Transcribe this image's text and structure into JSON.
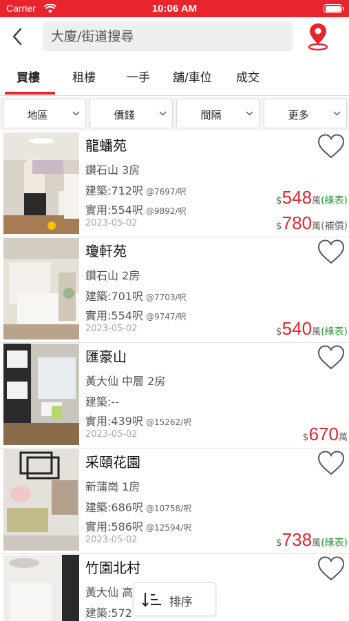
{
  "status_bar": {
    "carrier": "Carrier",
    "time": "10:06 AM"
  },
  "search": {
    "placeholder": "大廈/街道搜尋"
  },
  "tabs": [
    {
      "label": "買樓",
      "active": true
    },
    {
      "label": "租樓",
      "active": false
    },
    {
      "label": "一手",
      "active": false
    },
    {
      "label": "舖/車位",
      "active": false
    },
    {
      "label": "成交",
      "active": false
    }
  ],
  "filters": [
    {
      "label": "地區"
    },
    {
      "label": "價錢"
    },
    {
      "label": "間隔"
    },
    {
      "label": "更多"
    }
  ],
  "listings": [
    {
      "title": "龍蟠苑",
      "district": "鑽石山  3房",
      "gross": "建築:712呎",
      "gross_unit": "@7697/呎",
      "net": "實用:554呎",
      "net_unit": "@9892/呎",
      "date": "2023-05-02",
      "prices": [
        {
          "currency": "$",
          "amount": "548",
          "unit": "萬",
          "tag": "(綠表)",
          "tag_color": "green"
        },
        {
          "currency": "$",
          "amount": "780",
          "unit": "萬",
          "tag": "(補價)",
          "tag_color": "grey"
        }
      ]
    },
    {
      "title": "瓊軒苑",
      "district": "鑽石山  2房",
      "gross": "建築:701呎",
      "gross_unit": "@7703/呎",
      "net": "實用:554呎",
      "net_unit": "@9747/呎",
      "date": "2023-05-02",
      "prices": [
        {
          "currency": "$",
          "amount": "540",
          "unit": "萬",
          "tag": "(綠表)",
          "tag_color": "green"
        }
      ]
    },
    {
      "title": "匯豪山",
      "district": "黃大仙 中層 2房",
      "gross": "建築:--",
      "gross_unit": "",
      "net": "實用:439呎",
      "net_unit": "@15262/呎",
      "date": "2023-05-02",
      "prices": [
        {
          "currency": "$",
          "amount": "670",
          "unit": "萬",
          "tag": "",
          "tag_color": ""
        }
      ]
    },
    {
      "title": "采頤花園",
      "district": "新蒲崗  1房",
      "gross": "建築:686呎",
      "gross_unit": "@10758/呎",
      "net": "實用:586呎",
      "net_unit": "@12594/呎",
      "date": "2023-05-02",
      "prices": [
        {
          "currency": "$",
          "amount": "738",
          "unit": "萬",
          "tag": "(綠表)",
          "tag_color": "green"
        }
      ]
    },
    {
      "title": "竹園北村",
      "district": "黃大仙 高",
      "gross": "建築:572",
      "gross_unit": "",
      "net": "",
      "net_unit": "",
      "date": "",
      "prices": []
    }
  ],
  "sort_button": {
    "label": "排序"
  },
  "colors": {
    "brand_red": "#e8242c",
    "green_tag": "#1d9a2f"
  },
  "icons": [
    "back-arrow-icon",
    "map-pin-icon",
    "heart-icon",
    "chevron-down-icon",
    "sort-icon",
    "wifi-icon",
    "battery-icon"
  ]
}
